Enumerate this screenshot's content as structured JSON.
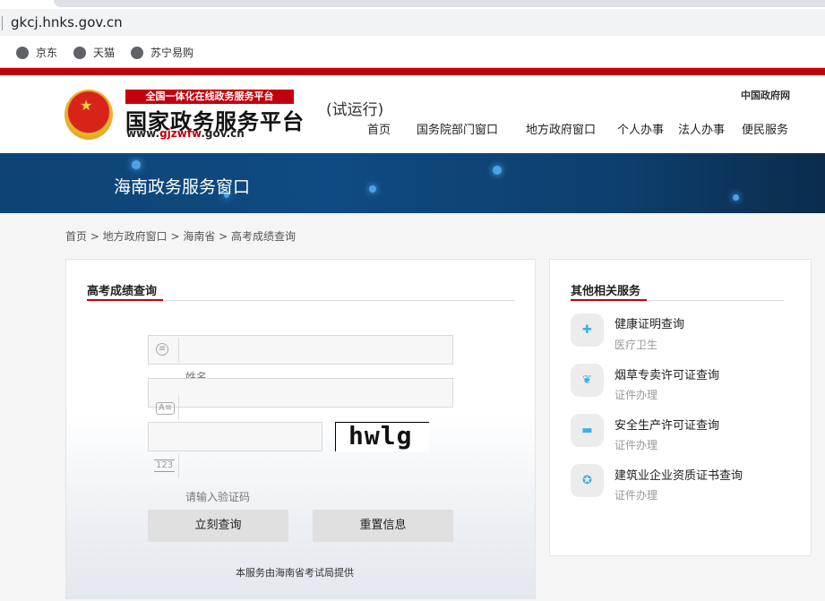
{
  "browser": {
    "url": "gkcj.hnks.gov.cn",
    "bookmarks": [
      {
        "label": "京东",
        "icon": "globe-icon"
      },
      {
        "label": "天猫",
        "icon": "globe-icon"
      },
      {
        "label": "苏宁易购",
        "icon": "globe-icon"
      }
    ]
  },
  "header": {
    "logo_banner": "全国一体化在线政务服务平台",
    "logo_title": "国家政务服务平台",
    "logo_url_prefix": "www.",
    "logo_url_highlight": "gjzwfw",
    "logo_url_suffix": ".gov.cn",
    "trial": "(试运行)",
    "gov_link": "中国政府网",
    "nav": [
      "首页",
      "国务院部门窗口",
      "地方政府窗口",
      "个人办事",
      "法人办事",
      "便民服务"
    ],
    "brand_color": "#c3000e"
  },
  "banner": {
    "title": "海南政务服务窗口"
  },
  "breadcrumb": "首页 > 地方政府窗口 > 海南省 > 高考成绩查询",
  "form": {
    "title": "高考成绩查询",
    "name_placeholder": "姓名",
    "captcha_placeholder": "请输入验证码",
    "captcha_text": "hwlg",
    "submit_label": "立刻查询",
    "reset_label": "重置信息",
    "provider": "本服务由海南省考试局提供"
  },
  "services": {
    "title": "其他相关服务",
    "items": [
      {
        "title": "健康证明查询",
        "category": "医疗卫生",
        "icon": "medical-icon"
      },
      {
        "title": "烟草专卖许可证查询",
        "category": "证件办理",
        "icon": "leaf-icon"
      },
      {
        "title": "安全生产许可证查询",
        "category": "证件办理",
        "icon": "helmet-icon"
      },
      {
        "title": "建筑业企业资质证书查询",
        "category": "证件办理",
        "icon": "certificate-icon"
      }
    ]
  }
}
